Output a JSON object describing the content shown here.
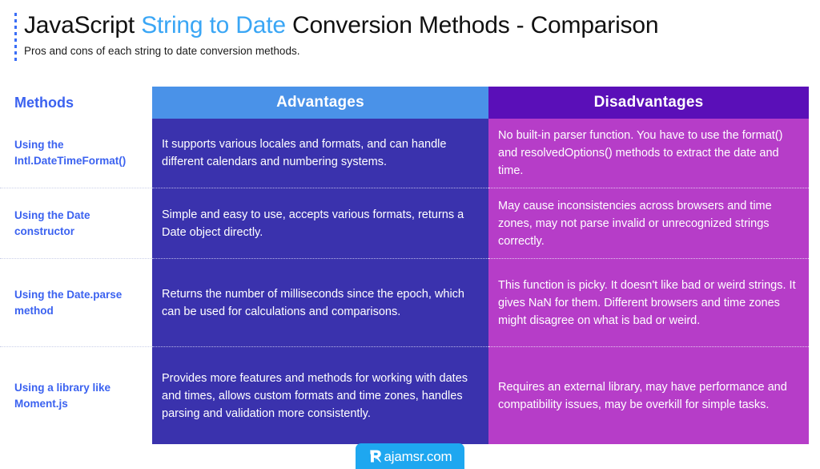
{
  "header": {
    "title_part1": "JavaScript ",
    "title_highlight": "String to Date",
    "title_part2": " Conversion Methods - Comparison",
    "subtitle": "Pros and cons of each string to date conversion methods.",
    "highlight_color": "#3aa6f5",
    "accent_color": "#3b6ef6"
  },
  "table": {
    "columns": [
      {
        "label": "Methods",
        "bg": "#ffffff",
        "color": "#3b62f0"
      },
      {
        "label": "Advantages",
        "bg": "#4a92e8",
        "color": "#ffffff"
      },
      {
        "label": "Disadvantages",
        "bg": "#5a0fb8",
        "color": "#ffffff"
      }
    ],
    "rows": [
      {
        "method": "Using the Intl.DateTimeFormat()",
        "advantage": "It supports various locales and formats, and can handle different calendars and numbering systems.",
        "disadvantage": "No built-in parser function. You have to use the format() and resolvedOptions() methods to extract the date and time."
      },
      {
        "method": "Using the Date constructor",
        "advantage": "Simple and easy to use, accepts various formats, returns a Date object directly.",
        "disadvantage": "May cause inconsistencies across browsers and time zones, may not parse invalid or unrecognized strings correctly."
      },
      {
        "method": "Using the Date.parse method",
        "advantage": "Returns the number of milliseconds since the epoch, which can be used for calculations and comparisons.",
        "disadvantage": "This function is picky. It doesn't like bad or weird strings. It gives NaN for them. Different browsers and time zones might disagree on what is bad or weird."
      },
      {
        "method": "Using a library like Moment.js",
        "advantage": "Provides more features and methods for working with dates and times, allows custom formats and time zones, handles parsing and validation more consistently.",
        "disadvantage": "Requires an external library, may have performance and compatibility issues, may be overkill for simple tasks."
      }
    ],
    "cell_colors": {
      "advantages_body": "#3a32ad",
      "disadvantages_body": "#b63dc8"
    }
  },
  "footer": {
    "brand_text": "ajamsr.com",
    "brand_icon": "rajamsr-r-logo-icon",
    "badge_color": "#1ea7f0"
  }
}
